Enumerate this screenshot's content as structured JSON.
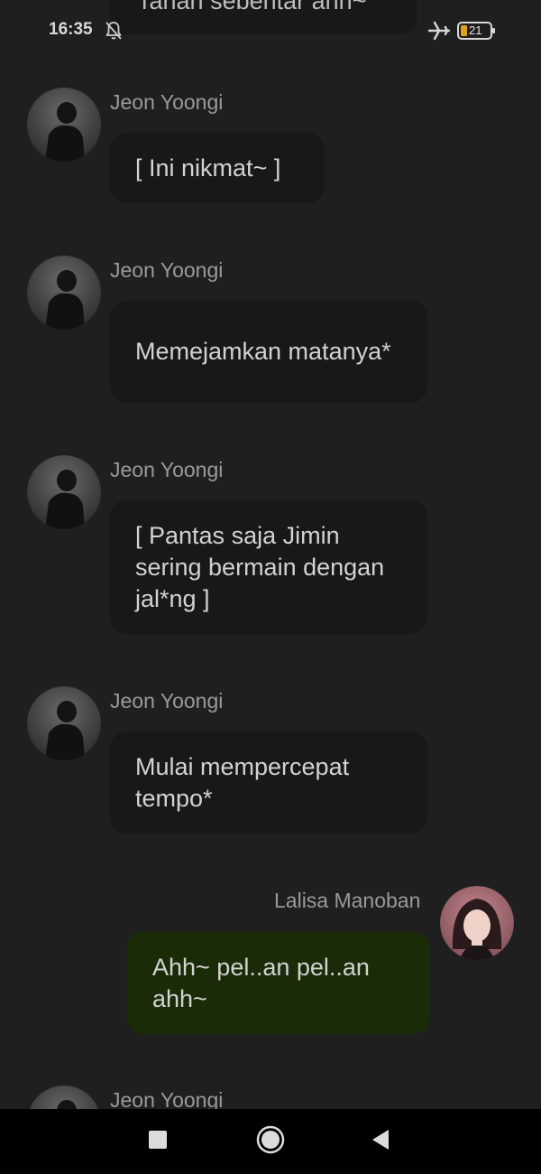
{
  "status_bar": {
    "time": "16:35",
    "battery": "21",
    "icons": [
      "bell-off-icon",
      "airplane-icon",
      "battery-icon"
    ]
  },
  "partial_top_message": {
    "text": "Tahan sebentar ahh~"
  },
  "messages": [
    {
      "sender": "Jeon Yoongi",
      "text": "[ Ini nikmat~ ]",
      "side": "left"
    },
    {
      "sender": "Jeon Yoongi",
      "text": "Memejamkan matanya*",
      "side": "left"
    },
    {
      "sender": "Jeon Yoongi",
      "text": "[ Pantas saja Jimin sering bermain dengan jal*ng ]",
      "side": "left"
    },
    {
      "sender": "Jeon Yoongi",
      "text": "Mulai mempercepat tempo*",
      "side": "left"
    },
    {
      "sender": "Lalisa Manoban",
      "text": "Ahh~ pel..an pel..an ahh~",
      "side": "right"
    },
    {
      "sender": "Jeon Yoongi",
      "text": "",
      "side": "left"
    }
  ],
  "nav_bar": {
    "buttons": [
      "recents-icon",
      "home-icon",
      "back-icon"
    ]
  },
  "colors": {
    "background": "#1f1f1f",
    "bubble_other": "#181818",
    "bubble_self": "#1a2c07",
    "sender_text": "#9a9a9a",
    "nav_background": "#000000"
  }
}
